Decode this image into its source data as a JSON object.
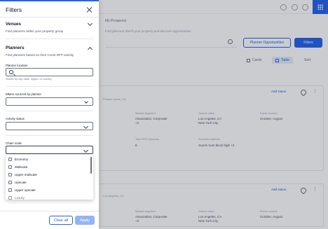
{
  "background": {
    "breadcrumb": "My Prospects",
    "subtitle": "Find planners that fit your property and discover opportunities",
    "buttons": {
      "outline": "Planner Opportunities",
      "filled": "Filters"
    },
    "views": {
      "cards": "Cards",
      "table": "Table",
      "sort": "Sort"
    },
    "cards": [
      {
        "header": "Planner name, CA",
        "action": "Add status",
        "labels": [
          "Market segment",
          "Search cities",
          "Event months"
        ],
        "values": [
          "Association, Corporate",
          "Los Angeles, CA",
          "October, August"
        ],
        "values2": [
          "+2",
          "New York City",
          ""
        ],
        "label2": [
          "Total RFP requests",
          "Accommodations"
        ],
        "value3": [
          "8",
          "Guest room block high +2"
        ]
      },
      {
        "header": "Los Angeles, CA",
        "action": "Add status",
        "labels": [
          "Market segment",
          "Search cities",
          "Event months"
        ],
        "values": [
          "Association, Corporate",
          "Los Angeles, CA",
          "October, August"
        ],
        "values2": [
          "+2",
          "New York City",
          ""
        ]
      }
    ]
  },
  "panel": {
    "title": "Filters",
    "venues": {
      "title": "Venues",
      "description": "Find planners within your property group"
    },
    "planners": {
      "title": "Planners",
      "description": "Find planners based on their Cvent RFP activity"
    },
    "planner_location": {
      "label": "Planner location",
      "value": "",
      "hint": "Search by city, state, region, or country"
    },
    "mmas": {
      "label": "MMAs sourced by planner",
      "value": ""
    },
    "activity_status": {
      "label": "Activity status",
      "value": ""
    },
    "chain_scale": {
      "label": "Chain scale",
      "value": "",
      "options": [
        "Economy",
        "Midscale",
        "Upper midscale",
        "Upscale",
        "Upper upscale",
        "Luxury"
      ]
    },
    "footer": {
      "clear_all": "Clear all",
      "apply": "Apply"
    }
  }
}
